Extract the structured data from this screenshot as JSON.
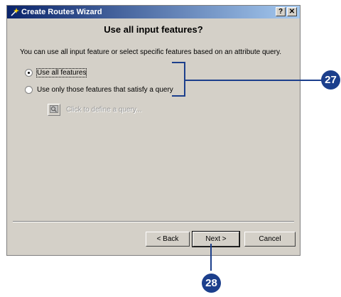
{
  "window": {
    "title": "Create Routes Wizard",
    "help_glyph": "?",
    "close_glyph": "✕"
  },
  "page": {
    "heading": "Use all input features?",
    "intro": "You can use all input feature or select specific features based on an attribute query."
  },
  "options": [
    {
      "label": "Use all features",
      "checked": true
    },
    {
      "label": "Use only those features that satisfy a query",
      "checked": false
    }
  ],
  "query": {
    "link_text": "Click to define a query...",
    "icon": "query-builder-icon"
  },
  "buttons": {
    "back": "< Back",
    "next": "Next >",
    "cancel": "Cancel"
  },
  "callouts": {
    "a": "27",
    "b": "28",
    "color": "#1c3f8c"
  }
}
